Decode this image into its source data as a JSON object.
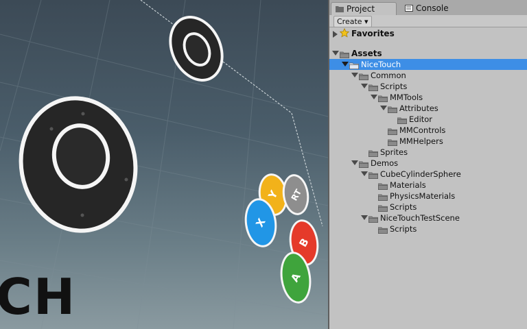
{
  "tabs": [
    {
      "label": "Project",
      "active": true,
      "icon": "folder-icon"
    },
    {
      "label": "Console",
      "active": false,
      "icon": "console-icon"
    }
  ],
  "toolbar": {
    "create_label": "Create ▾"
  },
  "tree": [
    {
      "label": "Favorites",
      "depth": 0,
      "expanded": false,
      "bold": true,
      "icon": "star-icon"
    },
    {
      "label": "Assets",
      "depth": 0,
      "expanded": true,
      "bold": true,
      "icon": "folder-icon"
    },
    {
      "label": "NiceTouch",
      "depth": 1,
      "expanded": true,
      "selected": true,
      "icon": "folder-icon"
    },
    {
      "label": "Common",
      "depth": 2,
      "expanded": true,
      "icon": "folder-icon"
    },
    {
      "label": "Scripts",
      "depth": 3,
      "expanded": true,
      "icon": "folder-icon"
    },
    {
      "label": "MMTools",
      "depth": 4,
      "expanded": true,
      "icon": "folder-icon"
    },
    {
      "label": "Attributes",
      "depth": 5,
      "expanded": true,
      "icon": "folder-icon"
    },
    {
      "label": "Editor",
      "depth": 6,
      "expanded": null,
      "icon": "folder-icon"
    },
    {
      "label": "MMControls",
      "depth": 5,
      "expanded": null,
      "icon": "folder-icon"
    },
    {
      "label": "MMHelpers",
      "depth": 5,
      "expanded": null,
      "icon": "folder-icon"
    },
    {
      "label": "Sprites",
      "depth": 3,
      "expanded": null,
      "icon": "folder-icon"
    },
    {
      "label": "Demos",
      "depth": 2,
      "expanded": true,
      "icon": "folder-icon"
    },
    {
      "label": "CubeCylinderSphere",
      "depth": 3,
      "expanded": true,
      "icon": "folder-icon"
    },
    {
      "label": "Materials",
      "depth": 4,
      "expanded": null,
      "icon": "folder-icon"
    },
    {
      "label": "PhysicsMaterials",
      "depth": 4,
      "expanded": null,
      "icon": "folder-icon"
    },
    {
      "label": "Scripts",
      "depth": 4,
      "expanded": null,
      "icon": "folder-icon"
    },
    {
      "label": "NiceTouchTestScene",
      "depth": 3,
      "expanded": true,
      "icon": "folder-icon"
    },
    {
      "label": "Scripts",
      "depth": 4,
      "expanded": null,
      "icon": "folder-icon"
    }
  ],
  "scene": {
    "buttons": [
      {
        "letter": "Y",
        "color": "#f2b21a"
      },
      {
        "letter": "RT",
        "color": "#8e8e8e"
      },
      {
        "letter": "X",
        "color": "#2196e6"
      },
      {
        "letter": "B",
        "color": "#e53a2a"
      },
      {
        "letter": "A",
        "color": "#3fa43c"
      }
    ],
    "logo_text": "CH"
  },
  "colors": {
    "selection": "#3d8ee6",
    "panel_bg": "#c2c2c2",
    "folder": "#8a8a8a"
  }
}
